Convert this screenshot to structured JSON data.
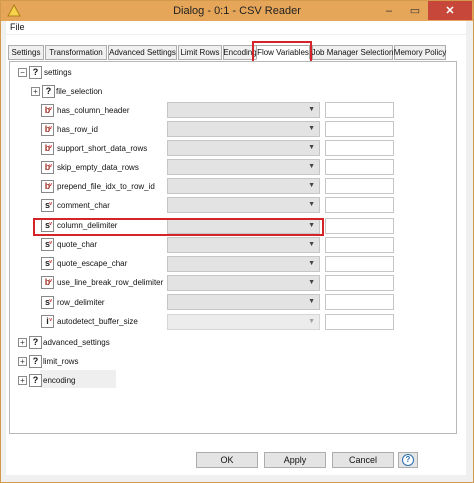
{
  "window": {
    "title": "Dialog - 0:1 - CSV Reader",
    "minimize_glyph": "–",
    "maximize_glyph": "▭",
    "close_glyph": "✕"
  },
  "menu": {
    "file": "File"
  },
  "tabs": [
    {
      "label": "Settings"
    },
    {
      "label": "Transformation"
    },
    {
      "label": "Advanced Settings"
    },
    {
      "label": "Limit Rows"
    },
    {
      "label": "Encoding"
    },
    {
      "label": "Flow Variables",
      "active": true
    },
    {
      "label": "Job Manager Selection"
    },
    {
      "label": "Memory Policy"
    }
  ],
  "tree": {
    "root": "settings",
    "file_selection": "file_selection",
    "params": [
      {
        "name": "has_column_header",
        "type": "b"
      },
      {
        "name": "has_row_id",
        "type": "b"
      },
      {
        "name": "support_short_data_rows",
        "type": "b"
      },
      {
        "name": "skip_empty_data_rows",
        "type": "b"
      },
      {
        "name": "prepend_file_idx_to_row_id",
        "type": "b"
      },
      {
        "name": "comment_char",
        "type": "s"
      },
      {
        "name": "column_delimiter",
        "type": "s"
      },
      {
        "name": "quote_char",
        "type": "s"
      },
      {
        "name": "quote_escape_char",
        "type": "s"
      },
      {
        "name": "use_line_break_row_delimiter",
        "type": "b"
      },
      {
        "name": "row_delimiter",
        "type": "s"
      },
      {
        "name": "autodetect_buffer_size",
        "type": "i"
      }
    ],
    "collapsed": [
      "advanced_settings",
      "limit_rows",
      "encoding"
    ],
    "expander_collapsed": "+",
    "expander_expanded": "−",
    "unknown_type": "?",
    "var_marker": "v",
    "chevron": "▼"
  },
  "buttons": {
    "ok": "OK",
    "apply": "Apply",
    "cancel": "Cancel",
    "help": "?"
  },
  "colors": {
    "titlebar": "#e6a65a",
    "highlight": "#d6232a",
    "close": "#c7473a"
  }
}
